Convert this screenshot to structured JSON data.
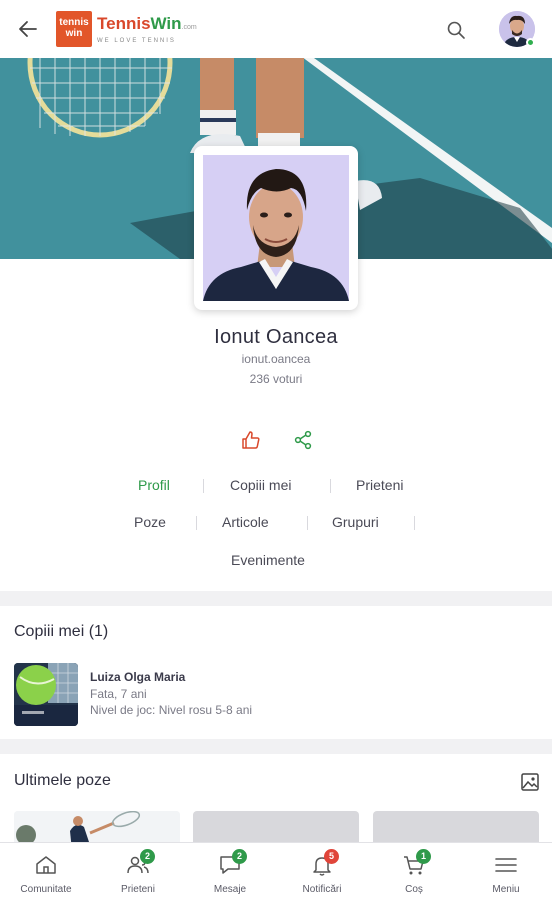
{
  "header": {
    "logo_box_text": "tennis win",
    "brand_tennis": "Tennis",
    "brand_win": "Win",
    "brand_com": ".com",
    "tagline": "WE LOVE TENNIS"
  },
  "profile": {
    "name": "Ionut Oancea",
    "username": "ionut.oancea",
    "votes": "236 voturi"
  },
  "tabs": [
    {
      "label": "Profil",
      "active": true
    },
    {
      "label": "Copiii mei"
    },
    {
      "label": "Prieteni"
    },
    {
      "label": "Poze"
    },
    {
      "label": "Articole"
    },
    {
      "label": "Grupuri"
    },
    {
      "label": "Evenimente"
    }
  ],
  "children_section": {
    "title": "Copiii mei (1)",
    "child": {
      "name": "Luiza Olga Maria",
      "details": "Fata, 7 ani",
      "level": "Nivel de joc: Nivel rosu 5-8 ani"
    }
  },
  "photos_section": {
    "title": "Ultimele poze"
  },
  "bottom_nav": [
    {
      "label": "Comunitate",
      "icon": "home-icon"
    },
    {
      "label": "Prieteni",
      "icon": "friends-icon",
      "badge": "2",
      "badge_color": "#2f9a4a"
    },
    {
      "label": "Mesaje",
      "icon": "message-icon",
      "badge": "2",
      "badge_color": "#2f9a4a"
    },
    {
      "label": "Notificări",
      "icon": "bell-icon",
      "badge": "5",
      "badge_color": "#e0453a"
    },
    {
      "label": "Coș",
      "icon": "cart-icon",
      "badge": "1",
      "badge_color": "#2f9a4a"
    },
    {
      "label": "Meniu",
      "icon": "menu-icon"
    }
  ],
  "colors": {
    "accent_green": "#2f9a4a",
    "brand_orange": "#e2562a",
    "like_red": "#d9482b"
  }
}
